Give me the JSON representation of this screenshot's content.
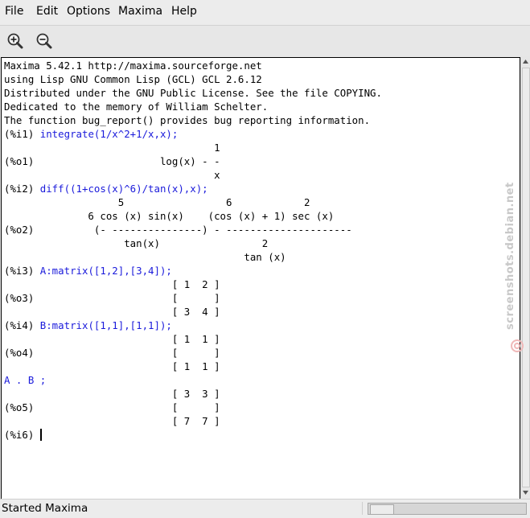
{
  "menu": {
    "file": "File",
    "edit": "Edit",
    "options": "Options",
    "maxima": "Maxima",
    "help": "Help"
  },
  "toolbar": {
    "zoom_in_icon": "zoom-in-icon",
    "zoom_out_icon": "zoom-out-icon"
  },
  "console": {
    "banner": [
      "Maxima 5.42.1 http://maxima.sourceforge.net",
      "using Lisp GNU Common Lisp (GCL) GCL 2.6.12",
      "Distributed under the GNU Public License. See the file COPYING.",
      "Dedicated to the memory of William Schelter.",
      "The function bug_report() provides bug reporting information."
    ],
    "i1_label": "(%i1) ",
    "i1_input": "integrate(1/x^2+1/x,x);",
    "o1": [
      "                                   1",
      "(%o1)                     log(x) - -",
      "                                   x"
    ],
    "i2_label": "(%i2) ",
    "i2_input": "diff((1+cos(x)^6)/tan(x),x);",
    "o2": [
      "                   5                 6            2",
      "              6 cos (x) sin(x)    (cos (x) + 1) sec (x)",
      "(%o2)          (- ---------------) - ---------------------",
      "                    tan(x)                 2",
      "                                        tan (x)"
    ],
    "i3_label": "(%i3) ",
    "i3_input": "A:matrix([1,2],[3,4]);",
    "o3": [
      "                            [ 1  2 ]",
      "(%o3)                       [      ]",
      "                            [ 3  4 ]"
    ],
    "i4_label": "(%i4) ",
    "i4_input": "B:matrix([1,1],[1,1]);",
    "o4": [
      "                            [ 1  1 ]",
      "(%o4)                       [      ]",
      "                            [ 1  1 ]"
    ],
    "i5_input": "A . B ;",
    "o5": [
      "                            [ 3  3 ]",
      "(%o5)                       [      ]",
      "                            [ 7  7 ]"
    ],
    "i6_label": "(%i6) "
  },
  "watermark": "screenshots.debian.net",
  "status": "Started Maxima",
  "colors": {
    "input_text": "#1a1adb",
    "output_text": "#000000",
    "console_bg": "#ffffff"
  }
}
